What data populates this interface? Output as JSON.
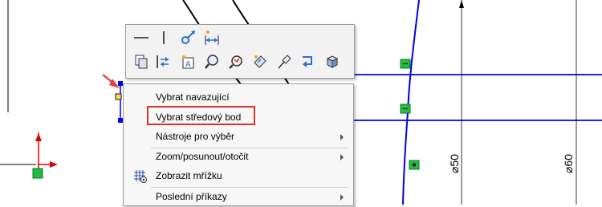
{
  "toolbar": {
    "buttons": [
      "horizontal-line-icon",
      "vertical-line-icon",
      "fix-relation-icon",
      "smart-dimension-icon",
      "layers-icon",
      "trim-icon",
      "note-icon",
      "zoom-icon",
      "rotate-view-icon",
      "sketch-tool-icon",
      "pin-icon",
      "undo-arrow-icon",
      "3d-box-icon"
    ]
  },
  "context_menu": {
    "items": [
      {
        "label": "Vybrat navazující",
        "submenu": false
      },
      {
        "label": "Vybrat středový bod",
        "submenu": false
      },
      {
        "label": "Nástroje pro výběr",
        "submenu": true
      },
      {
        "label": "Zoom/posunout/otočit",
        "submenu": true
      },
      {
        "label": "Zobrazit mřížku",
        "submenu": false,
        "icon": "grid-icon"
      },
      {
        "label": "Poslední příkazy",
        "submenu": true
      }
    ]
  },
  "dimensions": {
    "d1": "⌀50",
    "d2": "⌀60"
  },
  "colors": {
    "sketch_line": "#0000e6",
    "axis_red": "#e00000",
    "relation_marker": "#22bb44",
    "highlight_box": "#d9342b"
  }
}
